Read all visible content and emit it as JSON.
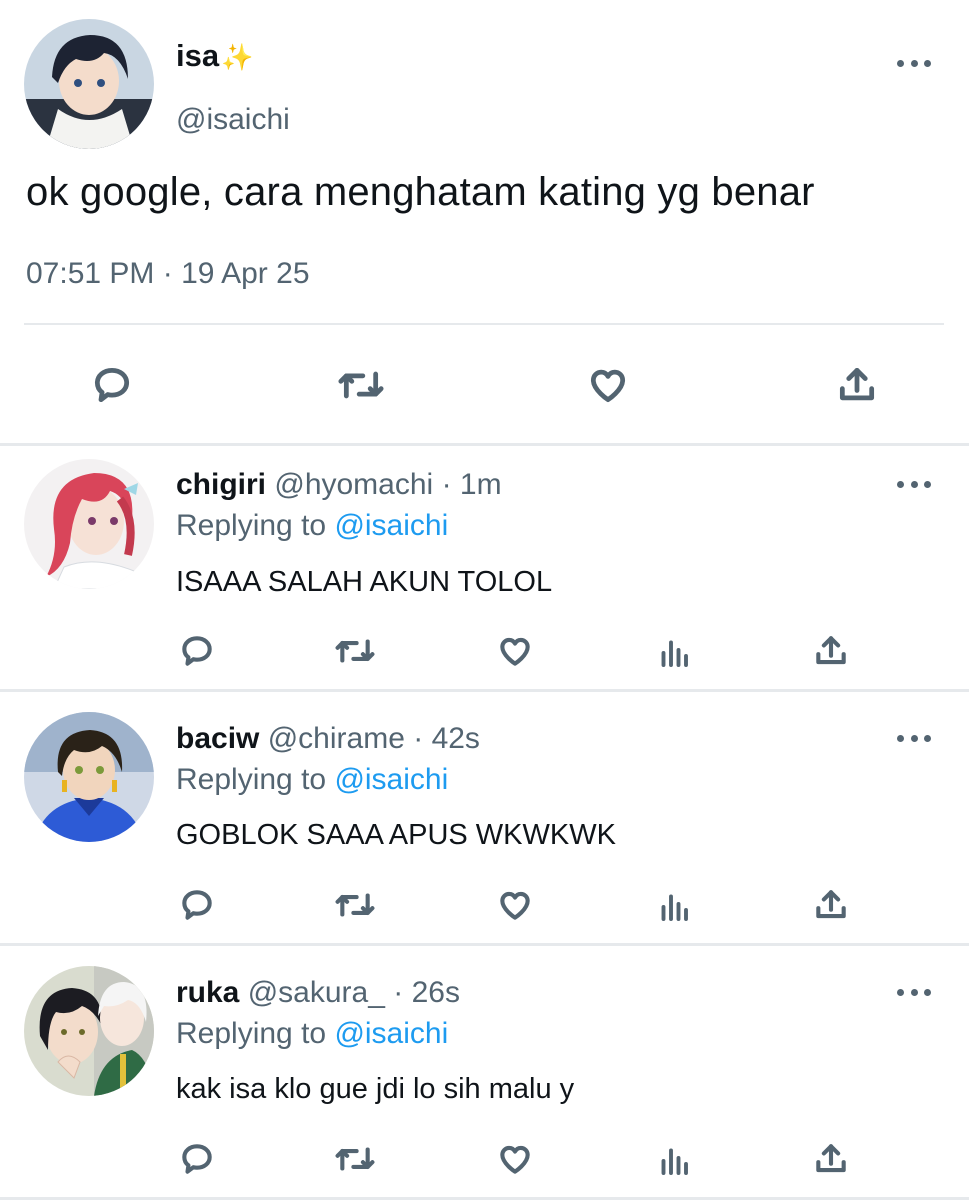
{
  "main_tweet": {
    "display_name": "isa",
    "name_emoji": "✨",
    "handle": "@isaichi",
    "text": "ok google, cara menghatam kating yg benar",
    "timestamp": "07:51 PM · 19 Apr 25",
    "actions": [
      "reply",
      "retweet",
      "like",
      "share"
    ]
  },
  "replies": [
    {
      "display_name": "chigiri",
      "handle": "@hyomachi",
      "separator": "·",
      "time": "1m",
      "replying_prefix": "Replying to",
      "replying_to": "@isaichi",
      "text": "ISAAA SALAH AKUN TOLOL"
    },
    {
      "display_name": "baciw",
      "handle": "@chirame",
      "separator": "·",
      "time": "42s",
      "replying_prefix": "Replying to",
      "replying_to": "@isaichi",
      "text": "GOBLOK SAAA APUS WKWKWK"
    },
    {
      "display_name": "ruka",
      "handle": "@sakura_",
      "separator": "·",
      "time": "26s",
      "replying_prefix": "Replying to",
      "replying_to": "@isaichi",
      "text": "kak isa klo gue jdi lo sih malu y"
    }
  ],
  "colors": {
    "text_primary": "#0f1419",
    "text_secondary": "#536471",
    "link": "#1d9bf0",
    "divider": "#e6e9ec",
    "sparkle": "#f5c518"
  },
  "icons": {
    "reply": "speech-bubble-icon",
    "retweet": "retweet-arrows-icon",
    "like": "heart-icon",
    "views": "bar-chart-icon",
    "share": "upload-arrow-icon",
    "more": "three-dots-icon"
  }
}
